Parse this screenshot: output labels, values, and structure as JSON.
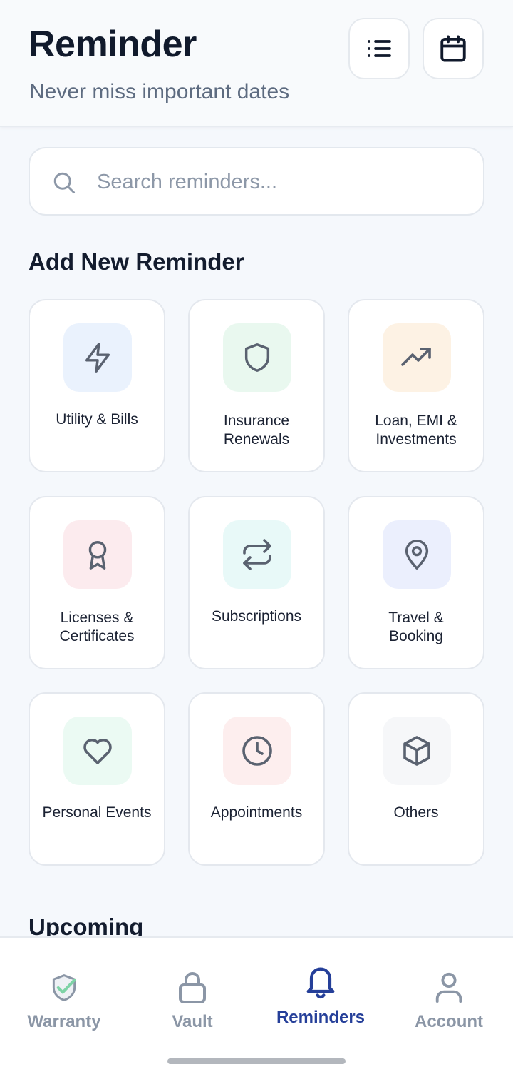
{
  "header": {
    "title": "Reminder",
    "subtitle": "Never miss important dates",
    "list_icon": "list-icon",
    "calendar_icon": "calendar-icon"
  },
  "search": {
    "placeholder": "Search reminders...",
    "value": ""
  },
  "add_section": {
    "title": "Add New Reminder",
    "categories": [
      {
        "label_lines": [
          "Utility & Bills"
        ],
        "icon": "lightning-icon",
        "tile_color": "#eaf2fd",
        "icon_color": "#5a6270"
      },
      {
        "label_lines": [
          "Insurance",
          "Renewals"
        ],
        "icon": "shield-icon",
        "tile_color": "#e9f8ef",
        "icon_color": "#5a6270"
      },
      {
        "label_lines": [
          "Loan, EMI &",
          "Investments"
        ],
        "icon": "trending-up-icon",
        "tile_color": "#fdf2e4",
        "icon_color": "#5a6270"
      },
      {
        "label_lines": [
          "Licenses &",
          "Certificates"
        ],
        "icon": "award-icon",
        "tile_color": "#fcebee",
        "icon_color": "#5a6270"
      },
      {
        "label_lines": [
          "Subscriptions"
        ],
        "icon": "repeat-icon",
        "tile_color": "#e8f9f8",
        "icon_color": "#5a6270"
      },
      {
        "label_lines": [
          "Travel &",
          "Booking"
        ],
        "icon": "map-pin-icon",
        "tile_color": "#ebeffd",
        "icon_color": "#5a6270"
      },
      {
        "label_lines": [
          "Personal Events"
        ],
        "icon": "heart-icon",
        "tile_color": "#ebfaf3",
        "icon_color": "#5a6270"
      },
      {
        "label_lines": [
          "Appointments"
        ],
        "icon": "clock-icon",
        "tile_color": "#fdeeee",
        "icon_color": "#5a6270"
      },
      {
        "label_lines": [
          "Others"
        ],
        "icon": "box-icon",
        "tile_color": "#f6f7f9",
        "icon_color": "#5a6270"
      }
    ]
  },
  "upcoming": {
    "title": "Upcoming"
  },
  "bottom_nav": {
    "items": [
      {
        "label": "Warranty",
        "icon": "warranty-shield-icon",
        "active": false
      },
      {
        "label": "Vault",
        "icon": "lock-icon",
        "active": false
      },
      {
        "label": "Reminders",
        "icon": "bell-icon",
        "active": true
      },
      {
        "label": "Account",
        "icon": "user-icon",
        "active": false
      }
    ],
    "active_color": "#253f99",
    "inactive_color": "#8b96a6"
  }
}
